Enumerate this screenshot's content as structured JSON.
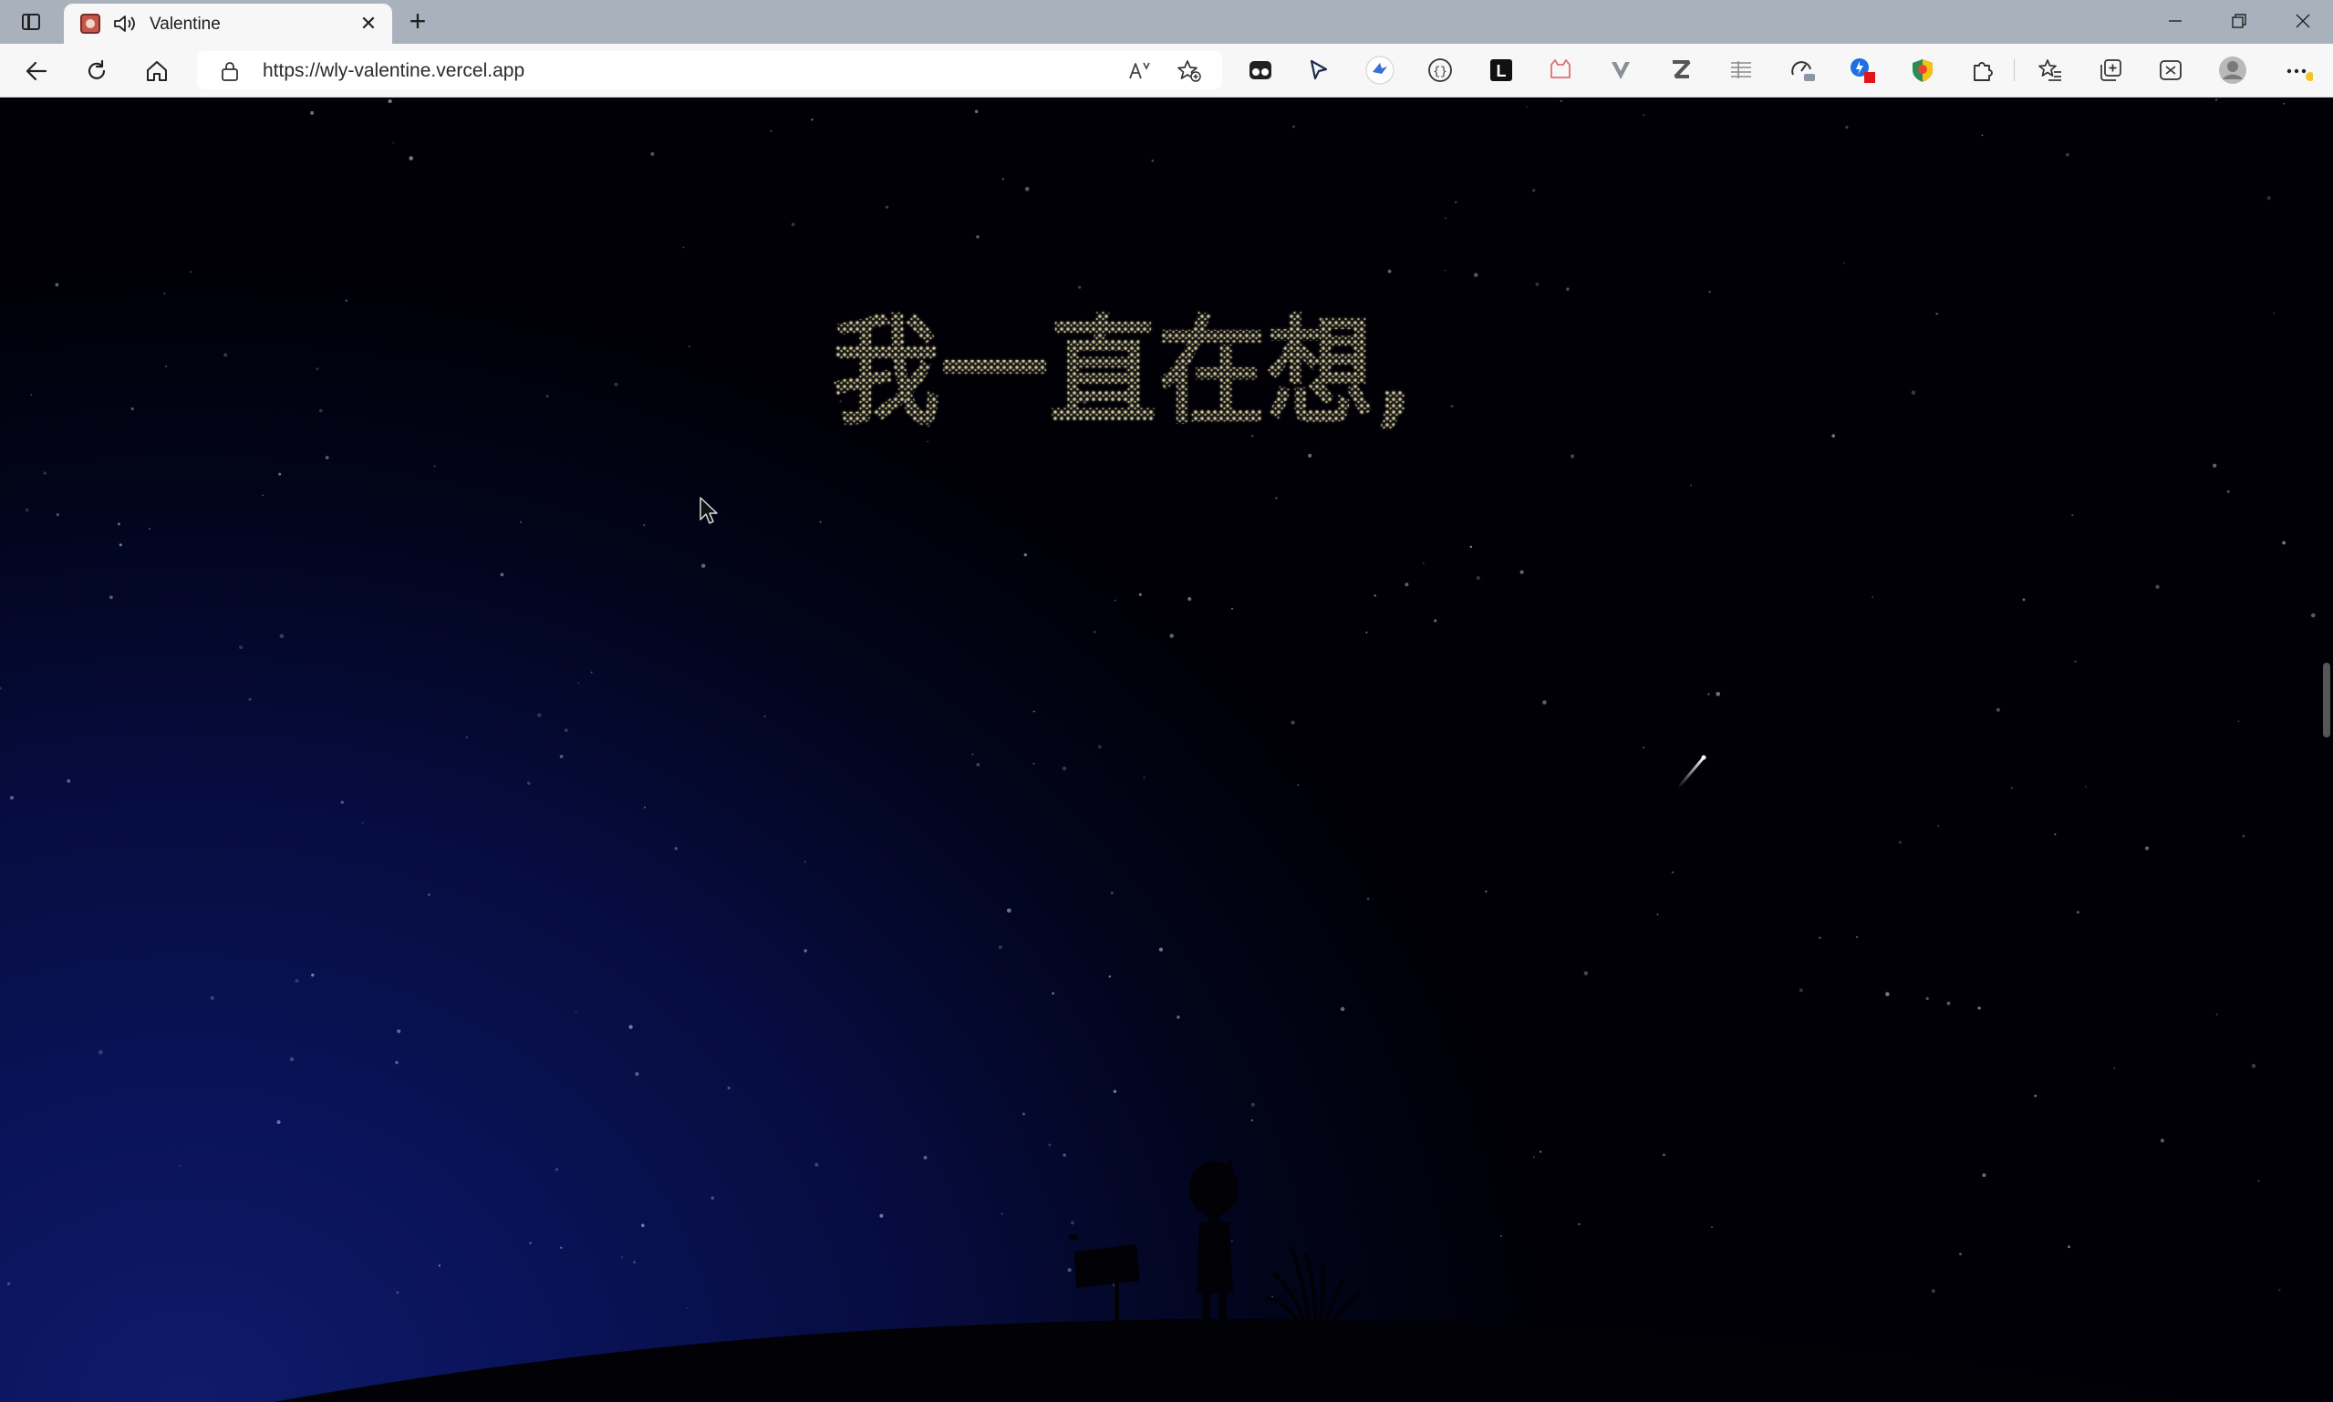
{
  "browser": {
    "tab": {
      "title": "Valentine",
      "audio_icon": "speaker-icon",
      "close_label": "✕"
    },
    "new_tab_label": "+",
    "window_controls": [
      "minimize-icon",
      "restore-icon",
      "close-icon"
    ],
    "address": {
      "url": "https://wly-valentine.vercel.app"
    },
    "nav_icons": [
      "back-arrow-icon",
      "refresh-icon",
      "home-icon"
    ],
    "address_icons": [
      "lock-icon",
      "read-aloud-icon",
      "add-favorite-icon"
    ],
    "extension_icons": [
      "tampermonkey-icon",
      "cursor-icon",
      "bird-icon",
      "braces-icon",
      "letter-l-icon",
      "cat-icon",
      "v-icon",
      "letter-z-icon",
      "table-icon",
      "speed-icon",
      "drop-icon",
      "shield-icon",
      "puzzle-icon",
      "favorites-icon",
      "collections-icon",
      "screenshot-icon",
      "profile-icon",
      "more-icon"
    ]
  },
  "page": {
    "star_text": "我一直在想,",
    "colors": {
      "star_text": "#e6dda8",
      "sky_deep": "#0a135a",
      "silhouette": "#010106"
    },
    "scene_icons": [
      "shooting-star-icon",
      "child-silhouette-icon",
      "signpost-icon",
      "grass-icon",
      "hill-icon"
    ]
  }
}
